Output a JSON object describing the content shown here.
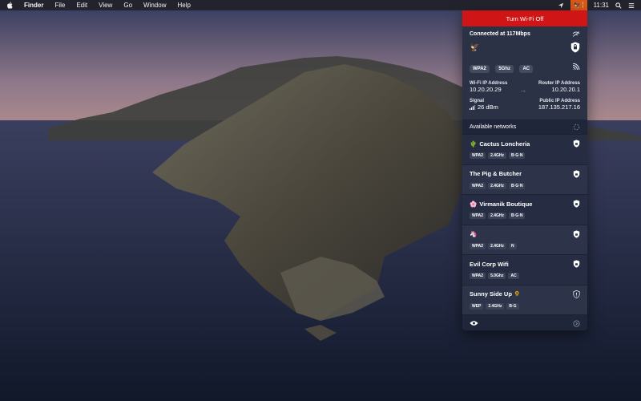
{
  "menubar": {
    "app_name": "Finder",
    "items": [
      "File",
      "Edit",
      "View",
      "Go",
      "Window",
      "Help"
    ],
    "clock": "11:31"
  },
  "panel": {
    "wifi_off_label": "Turn Wi-Fi Off",
    "connected_title": "Connected at 117Mbps",
    "chips": [
      "WPA2",
      "5Ghz",
      "AC"
    ],
    "wifi_ip_label": "Wi-Fi IP Address",
    "wifi_ip": "10.20.20.29",
    "router_ip_label": "Router IP Address",
    "router_ip": "10.20.20.1",
    "signal_label": "Signal",
    "signal_value": "26 dBm",
    "public_ip_label": "Public IP Address",
    "public_ip": "187.135.217.16",
    "available_label": "Available networks",
    "networks": [
      {
        "emoji": "🌵",
        "name": "Cactus Loncheria",
        "tags": [
          "WPA2",
          "2.4GHz",
          "B·G·N"
        ],
        "icon": "shield-lock-icon"
      },
      {
        "emoji": "",
        "name": "The Pig & Butcher",
        "tags": [
          "WPA2",
          "2.4GHz",
          "B·G·N"
        ],
        "icon": "shield-lock-icon"
      },
      {
        "emoji": "🌸",
        "name": "Virmanik Boutique",
        "tags": [
          "WPA2",
          "2.4GHz",
          "B·G·N"
        ],
        "icon": "shield-lock-icon"
      },
      {
        "emoji": "🦄",
        "name": "",
        "tags": [
          "WPA2",
          "2.4GHz",
          "N"
        ],
        "icon": "shield-lock-icon"
      },
      {
        "emoji": "",
        "name": "Evil Corp Wifi",
        "tags": [
          "WPA2",
          "5.0Ghz",
          "AC"
        ],
        "icon": "shield-lock-icon"
      },
      {
        "emoji": "🌻",
        "name": "Sunny Side Up",
        "tags": [
          "WEP",
          "2.4GHz",
          "B·G"
        ],
        "icon": "shield-warning-icon"
      }
    ]
  },
  "colors": {
    "accent_red": "#cf1515",
    "panel_bg": "#2b3245",
    "tray_orange": "#d85a1a"
  }
}
